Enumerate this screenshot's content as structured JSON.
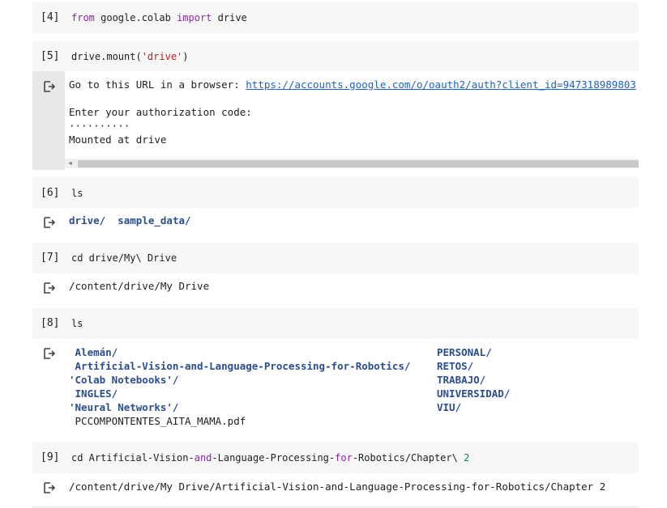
{
  "cells": [
    {
      "prompt": "[4]",
      "code": {
        "kw1": "from",
        "mod": " google.colab ",
        "kw2": "import",
        "rest": " drive"
      }
    },
    {
      "prompt": "[5]",
      "code": {
        "pre": "drive.mount(",
        "str": "'drive'",
        "post": ")"
      },
      "output": {
        "url_prefix": "Go to this URL in a browser: ",
        "url": "https://accounts.google.com/o/oauth2/auth?client_id=947318989803",
        "line2": "Enter your authorization code:",
        "line3": "··········",
        "line4": "Mounted at drive"
      }
    },
    {
      "prompt": "[6]",
      "code": {
        "text": "ls"
      },
      "output": {
        "items": [
          "drive/",
          "sample_data/"
        ]
      }
    },
    {
      "prompt": "[7]",
      "code": {
        "text": "cd drive/My\\ Drive"
      },
      "output": {
        "text": "/content/drive/My Drive"
      }
    },
    {
      "prompt": "[8]",
      "code": {
        "text": "ls"
      },
      "output": {
        "left": [
          " Alemán/",
          " Artificial-Vision-and-Language-Processing-for-Robotics/",
          "'Colab Notebooks'/",
          " INGLES/",
          "'Neural Networks'/",
          " PCCOMPONTENTES_AITA_MAMA.pdf"
        ],
        "right": [
          "PERSONAL/",
          "RETOS/",
          "TRABAJO/",
          "UNIVERSIDAD/",
          "VIU/"
        ]
      }
    },
    {
      "prompt": "[9]",
      "code": {
        "a": "cd Artificial-Vision-",
        "b": "and",
        "c": "-Language-Processing-",
        "d": "for",
        "e": "-Robotics/Chapter\\ ",
        "f": "2"
      },
      "output": {
        "text": "/content/drive/My Drive/Artificial-Vision-and-Language-Processing-for-Robotics/Chapter 2"
      }
    }
  ],
  "icons": {
    "output": "output-arrow-icon",
    "scroll_left": "scroll-left-arrow-icon"
  }
}
